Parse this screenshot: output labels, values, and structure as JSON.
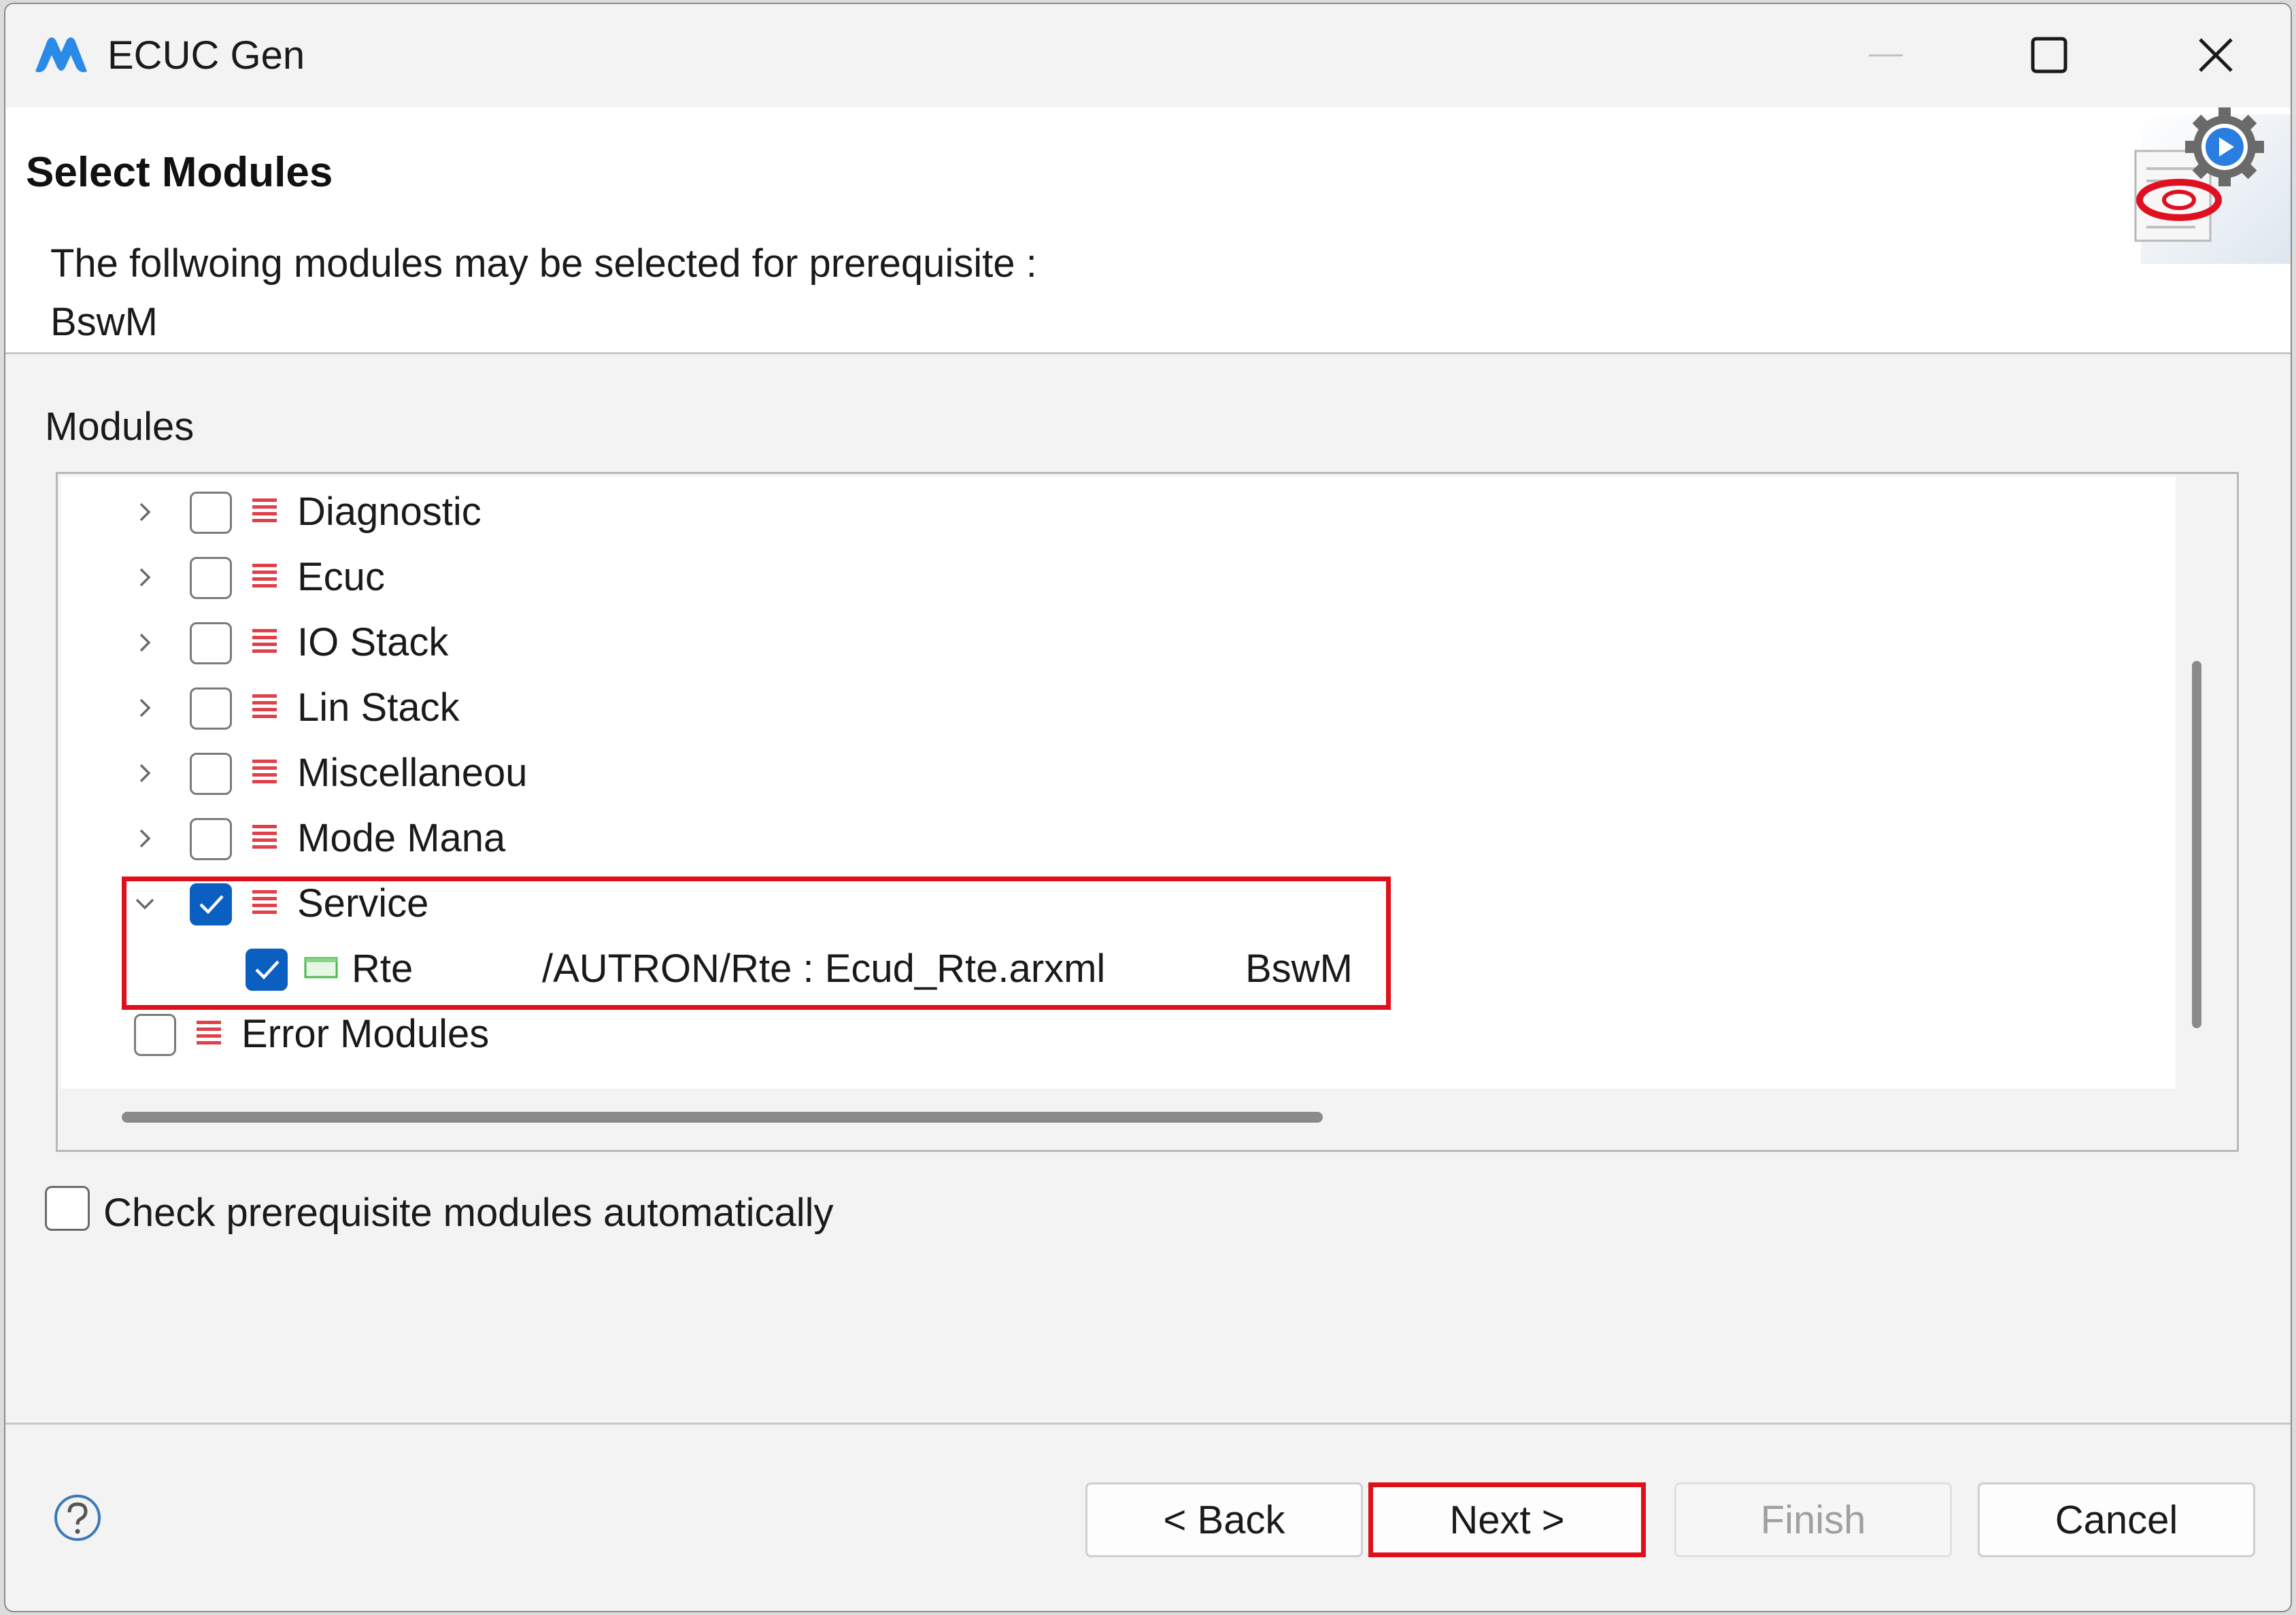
{
  "window": {
    "title": "ECUC Gen"
  },
  "header": {
    "title": "Select Modules",
    "description_line1": "The follwoing modules may be selected for prerequisite :",
    "description_line2": "BswM"
  },
  "modules": {
    "label": "Modules",
    "tree": [
      {
        "label": "Diagnostic",
        "checked": false,
        "expanded": false
      },
      {
        "label": "Ecuc",
        "checked": false,
        "expanded": false
      },
      {
        "label": "IO Stack",
        "checked": false,
        "expanded": false
      },
      {
        "label": "Lin Stack",
        "checked": false,
        "expanded": false
      },
      {
        "label": "Miscellaneou",
        "checked": false,
        "expanded": false
      },
      {
        "label": "Mode Mana",
        "checked": false,
        "expanded": false
      },
      {
        "label": "Service",
        "checked": true,
        "expanded": true,
        "children": [
          {
            "label": "Rte",
            "path": "/AUTRON/Rte : Ecud_Rte.arxml",
            "requiredBy": "BswM",
            "checked": true
          }
        ]
      },
      {
        "label": "Error Modules",
        "checked": false,
        "expanded": false
      }
    ]
  },
  "options": {
    "auto_check_label": "Check prerequisite modules automatically",
    "auto_check_checked": false
  },
  "buttons": {
    "back": "< Back",
    "next": "Next >",
    "finish": "Finish",
    "cancel": "Cancel"
  },
  "colors": {
    "accent": "#0a5fc0",
    "highlight": "#e0101a",
    "category_icon": "#e0404a"
  },
  "icons": {
    "app": "ecuc-gen-logo-icon",
    "wizard": "wizard-gear-icon",
    "help": "help-icon"
  }
}
